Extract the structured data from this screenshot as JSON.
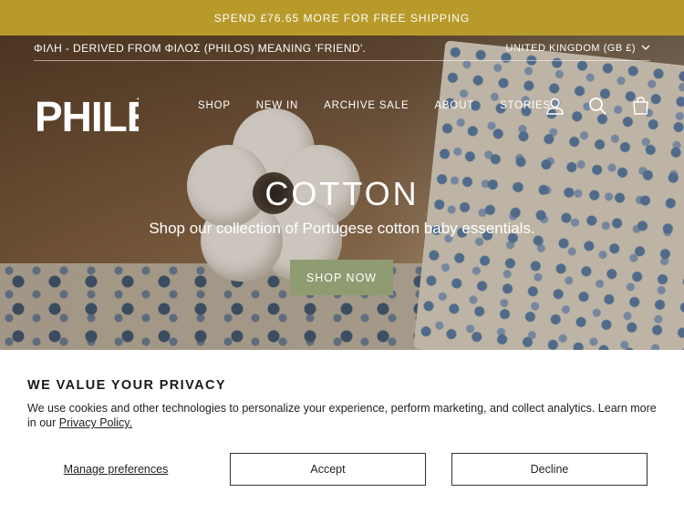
{
  "announcement": {
    "text": "SPEND £76.65 MORE FOR FREE SHIPPING"
  },
  "topbar": {
    "tagline": "ΦΙΛΗ - DERIVED FROM ΦΙΛΟΣ (PHILOS) MEANING 'FRIEND'.",
    "region": "UNITED KINGDOM (GB £)"
  },
  "brand": {
    "logo_text": "PHILÉ"
  },
  "nav": {
    "items": [
      "SHOP",
      "NEW IN",
      "ARCHIVE SALE",
      "ABOUT",
      "STORIES"
    ],
    "icons": [
      "account-icon",
      "search-icon",
      "cart-icon"
    ]
  },
  "hero": {
    "title": "COTTON",
    "subtitle": "Shop our collection of Portugese cotton baby essentials.",
    "cta_label": "SHOP NOW"
  },
  "privacy": {
    "heading": "WE VALUE YOUR PRIVACY",
    "body": "We use cookies and other technologies to personalize your experience, perform marketing, and collect analytics. Learn more in our ",
    "link": "Privacy Policy.",
    "manage_label": "Manage preferences",
    "accept_label": "Accept",
    "decline_label": "Decline"
  },
  "colors": {
    "announcement_bg": "#b89a2a",
    "cta_bg": "#8f9c72"
  }
}
